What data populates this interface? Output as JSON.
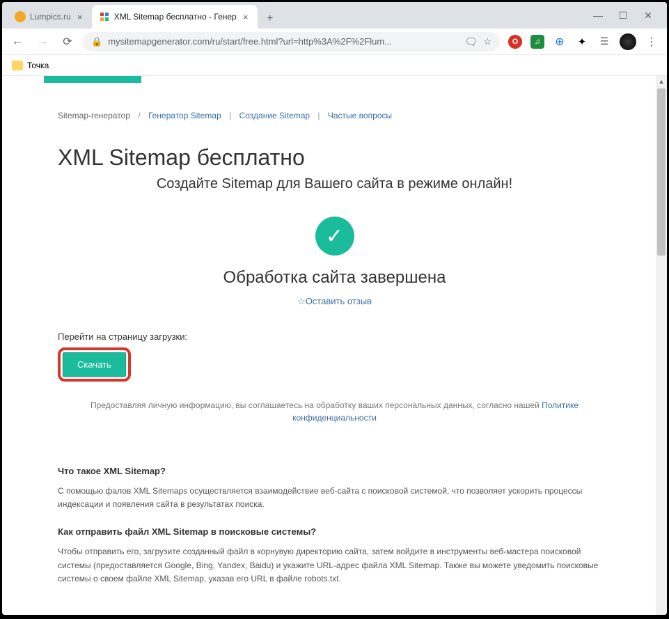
{
  "tabs": [
    {
      "title": "Lumpics.ru"
    },
    {
      "title": "XML Sitemap бесплатно - Генер"
    }
  ],
  "addressbar": {
    "url": "mysitemapgenerator.com/ru/start/free.html?url=http%3A%2F%2Flum..."
  },
  "bookmarks": {
    "item1": "Точка"
  },
  "breadcrumb": {
    "home": "Sitemap-генератор",
    "gen": "Генератор Sitemap",
    "create": "Создание Sitemap",
    "faq": "Частые вопросы"
  },
  "page_title": "XML Sitemap бесплатно",
  "subtitle": "Создайте Sitemap для Вашего сайта в режиме онлайн!",
  "status": "Обработка сайта завершена",
  "review_link": "Оставить отзыв",
  "download_label": "Перейти на страницу загрузки:",
  "download_btn": "Скачать",
  "privacy_text": "Предоставляя личную информацию, вы соглашаетесь на обработку ваших персональных данных, согласно нашей ",
  "privacy_link": "Политике конфиденциальности",
  "faq1_title": "Что такое XML Sitemap?",
  "faq1_text": "С помощью фалов XML Sitemaps осуществляется взаимодействие веб-сайта с поисковой системой, что позволяет ускорить процессы индексации и появления сайта в результатах поиска.",
  "faq2_title": "Как отправить файл XML Sitemap в поисковые системы?",
  "faq2_text": "Чтобы отправить его, загрузите созданный файл в корнувую директорию сайта, затем войдите в инструменты веб-мастера поисковой системы (предоставляется Google, Bing, Yandex, Baidu) и укажите URL-адрес файла XML Sitemap. Также вы можете уведомить поисковые системы о своем файле XML Sitemap, указав его URL в файле robots.txt."
}
